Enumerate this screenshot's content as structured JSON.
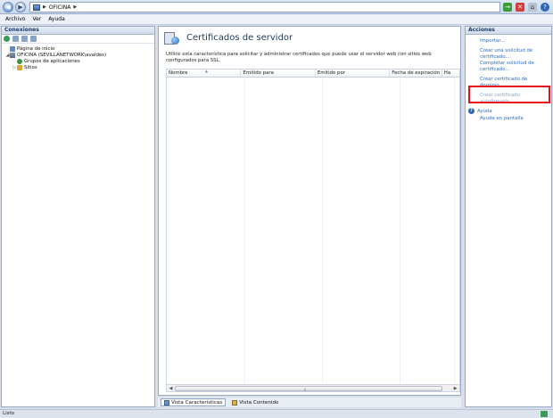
{
  "address_bar": {
    "path": [
      "OFICINA"
    ]
  },
  "menu": [
    "Archivo",
    "Ver",
    "Ayuda"
  ],
  "connections": {
    "title": "Conexiones",
    "tree": [
      {
        "label": "Página de inicio",
        "icon": "home-icon",
        "toggle": ""
      },
      {
        "label": "OFICINA (SEVILLANETWORK\\avaldes)",
        "icon": "server-icon",
        "toggle": "◢"
      },
      {
        "label": "Grupos de aplicaciones",
        "icon": "app-pool-icon",
        "toggle": ""
      },
      {
        "label": "Sitios",
        "icon": "sites-icon",
        "toggle": "▷"
      }
    ]
  },
  "main": {
    "title": "Certificados de servidor",
    "description": "Utilice esta característica para solicitar y administrar certificados que puede usar el servidor web con sitios web configurados para SSL.",
    "columns": [
      "Nombre",
      "Emitido para",
      "Emitido por",
      "Fecha de expiración",
      "Ha"
    ],
    "rows": []
  },
  "view_tabs": [
    {
      "label": "Vista Características",
      "active": true
    },
    {
      "label": "Vista Contenido",
      "active": false
    }
  ],
  "actions": {
    "title": "Acciones",
    "items": [
      {
        "label": "Importar...",
        "enabled": true
      },
      {
        "label": "Crear una solicitud de certificado...",
        "enabled": true
      },
      {
        "label": "Completar solicitud de certificado...",
        "enabled": true
      },
      {
        "label": "Crear certificado de dominio...",
        "enabled": true
      },
      {
        "label": "Crear certificado autofirmado...",
        "enabled": false
      }
    ],
    "help": [
      "Ayuda",
      "Ayuda en pantalla"
    ]
  },
  "status_bar": {
    "text": "Listo"
  },
  "colors": {
    "link": "#2f6cbf",
    "highlight": "#e8101a",
    "panel_header": "#1d3a63"
  }
}
